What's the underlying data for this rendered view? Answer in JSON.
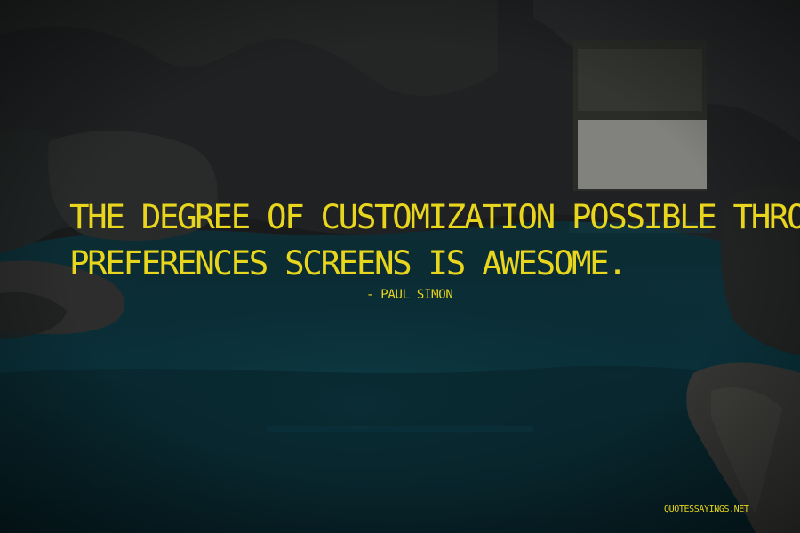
{
  "quote": {
    "line1": "THE DEGREE OF CUSTOMIZATION POSSIBLE THROUGH YOUR",
    "line2": "PREFERENCES SCREENS IS AWESOME."
  },
  "author": "- PAUL SIMON",
  "watermark": "QUOTESSAYINGS.NET",
  "colors": {
    "text": "#e8d51e",
    "water": "#0f3b47",
    "rock": "#2b2f30"
  }
}
